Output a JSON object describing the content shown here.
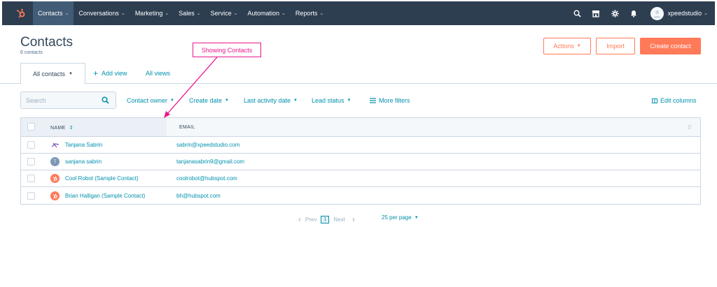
{
  "nav": {
    "items": [
      {
        "label": "Contacts",
        "active": true
      },
      {
        "label": "Conversations"
      },
      {
        "label": "Marketing"
      },
      {
        "label": "Sales"
      },
      {
        "label": "Service"
      },
      {
        "label": "Automation"
      },
      {
        "label": "Reports"
      }
    ],
    "username": "xpeedstudio",
    "icons": [
      "search-icon",
      "marketplace-icon",
      "settings-gear-icon",
      "notifications-bell-icon"
    ]
  },
  "header": {
    "title": "Contacts",
    "count": "6 contacts",
    "actions_label": "Actions",
    "import_label": "Import",
    "create_label": "Create contact"
  },
  "annotation": {
    "text": "Showing Contacts"
  },
  "tabs": {
    "active": "All contacts",
    "add_view": "Add view",
    "all_views": "All views"
  },
  "filters": {
    "search_placeholder": "Search",
    "contact_owner": "Contact owner",
    "create_date": "Create date",
    "last_activity_date": "Last activity date",
    "lead_status": "Lead status",
    "more_filters": "More filters",
    "edit_columns": "Edit columns"
  },
  "table": {
    "columns": [
      "NAME",
      "EMAIL"
    ],
    "rows": [
      {
        "name": "Tanjana Sabrin",
        "email": "sabrin@xpeedstudio.com",
        "avatar": "xpeed-logo"
      },
      {
        "name": "sanjana sabrin",
        "email": "tanjanasabrin9@gmail.com",
        "avatar": "initial",
        "initial": "T"
      },
      {
        "name": "Cool Robot (Sample Contact)",
        "email": "coolrobot@hubspot.com",
        "avatar": "hubspot"
      },
      {
        "name": "Brian Halligan (Sample Contact)",
        "email": "bh@hubspot.com",
        "avatar": "hubspot"
      }
    ]
  },
  "pagination": {
    "prev": "Prev",
    "page": "1",
    "next": "Next",
    "per_page": "25 per page"
  },
  "colors": {
    "nav_bg": "#2d3e50",
    "accent": "#ff7a59",
    "link": "#0091ae",
    "annotation": "#e8178a"
  }
}
